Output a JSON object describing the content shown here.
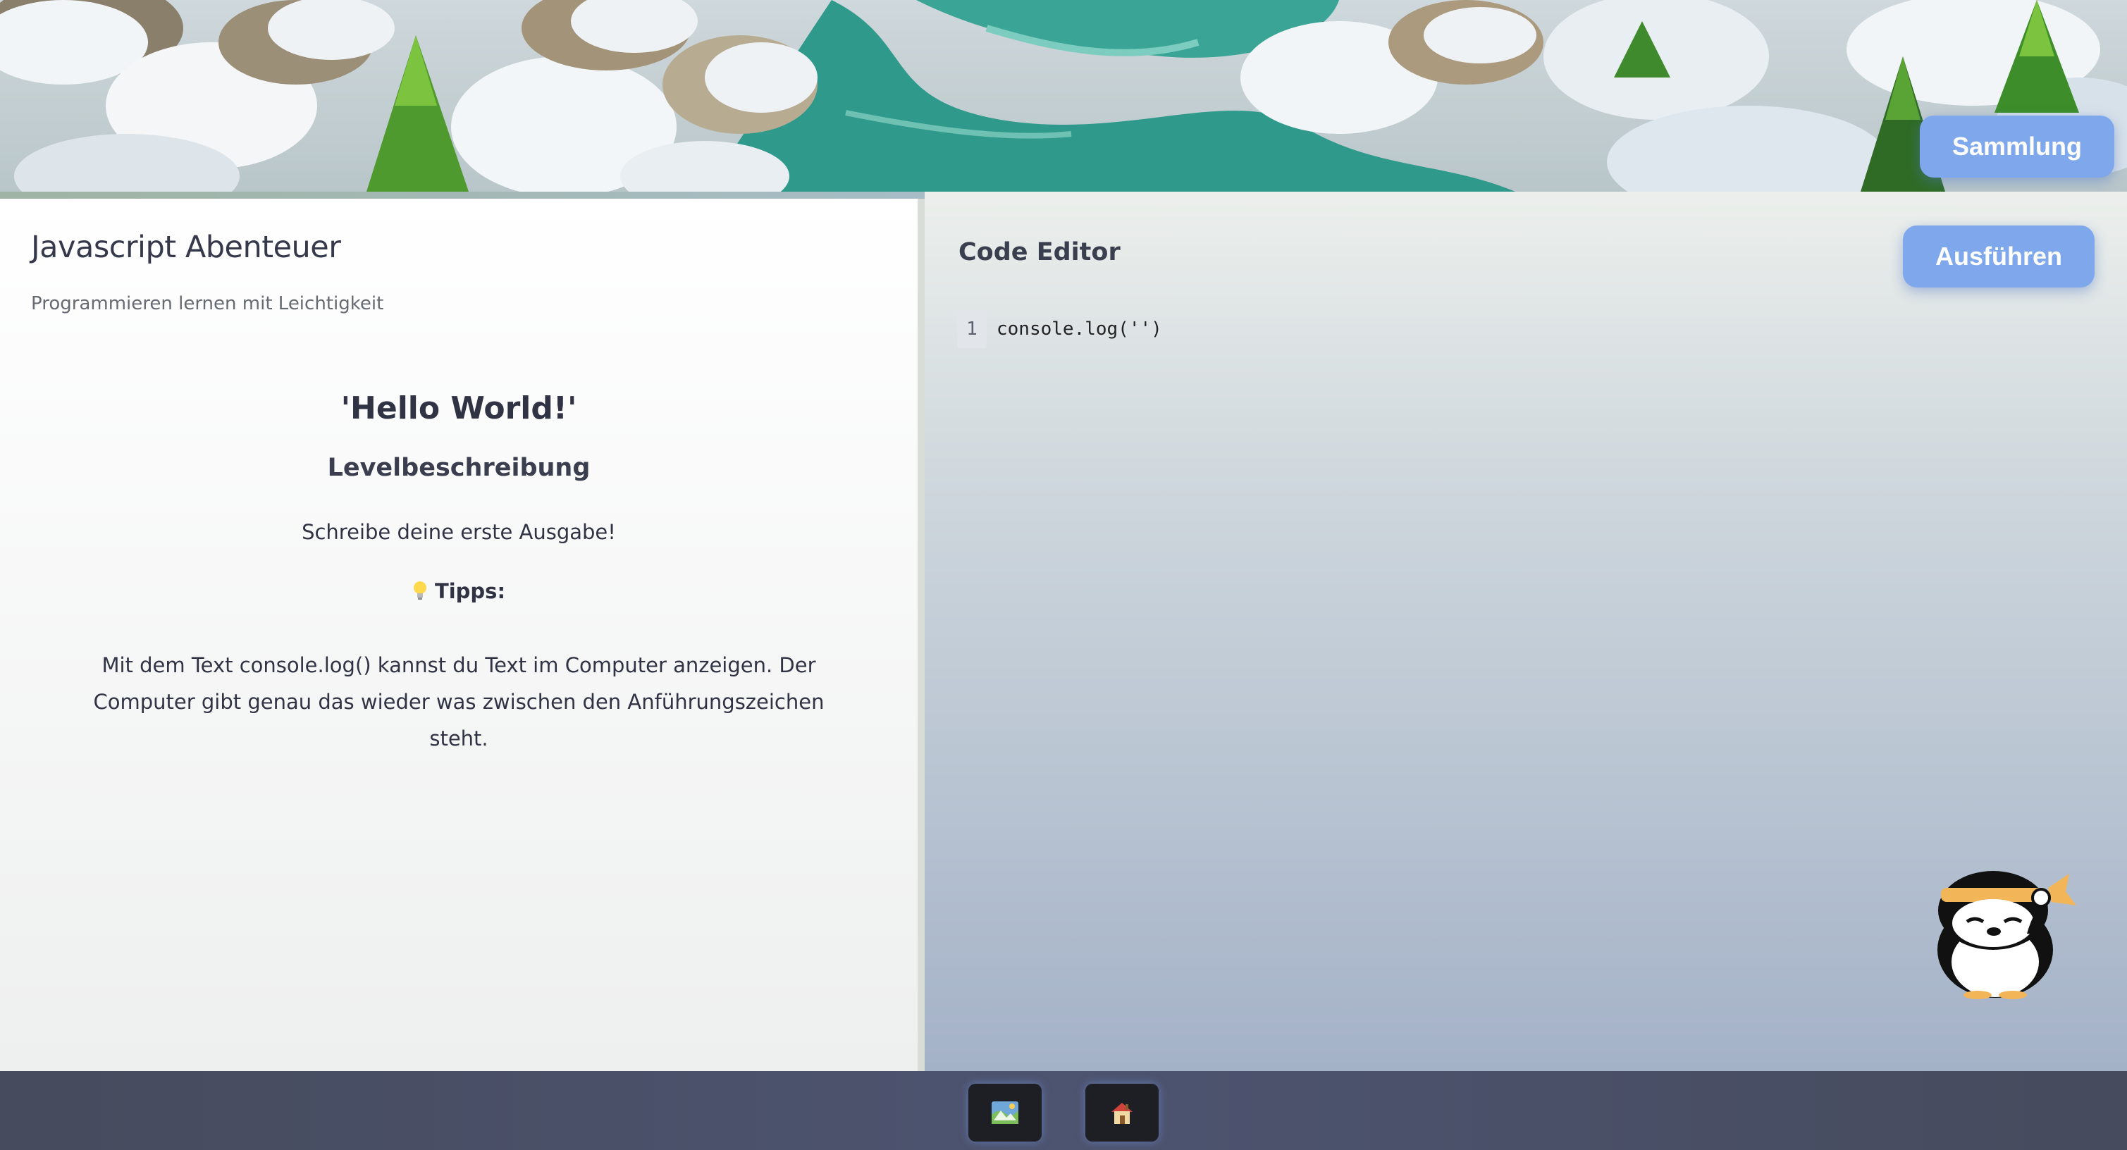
{
  "header": {
    "collection_button": "Sammlung"
  },
  "left_panel": {
    "app_title": "Javascript Abenteuer",
    "app_subtitle": "Programmieren lernen mit Leichtigkeit",
    "level_title": "'Hello World!'",
    "level_description_heading": "Levelbeschreibung",
    "level_task": "Schreibe deine erste Ausgabe!",
    "tips_label": "Tipps:",
    "tip_text": "Mit dem Text console.log() kannst du Text im Computer anzeigen. Der Computer gibt genau das wieder was zwischen den Anführungszeichen steht."
  },
  "editor": {
    "title": "Code Editor",
    "run_button": "Ausführen",
    "lines": [
      {
        "number": "1",
        "code": "console.log('')"
      }
    ]
  },
  "bottom_bar": {
    "buttons": [
      {
        "icon": "map-icon"
      },
      {
        "icon": "home-icon"
      }
    ]
  },
  "colors": {
    "accent_button": "#7fa7ec",
    "bottom_bar": "#46506a",
    "text_dark": "#2f3344"
  }
}
